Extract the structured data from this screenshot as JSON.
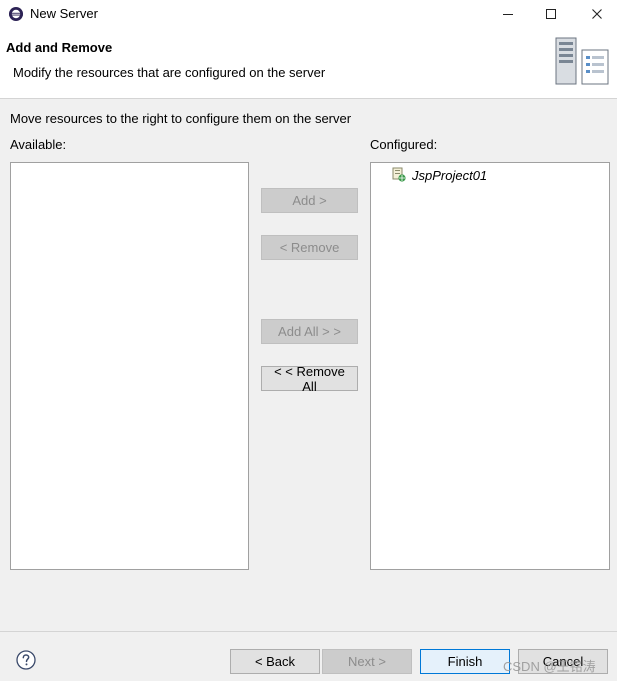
{
  "window": {
    "title": "New Server"
  },
  "header": {
    "title": "Add and Remove",
    "description": "Modify the resources that are configured on the server"
  },
  "main": {
    "instruction": "Move resources to the right to configure them on the server",
    "available": {
      "label": "Available:",
      "items": []
    },
    "configured": {
      "label": "Configured:",
      "items": [
        "JspProject01"
      ]
    }
  },
  "buttons": {
    "add": "Add >",
    "remove": "< Remove",
    "add_all": "Add All > >",
    "remove_all": "< < Remove All"
  },
  "footer": {
    "back": "< Back",
    "next": "Next >",
    "finish": "Finish",
    "cancel": "Cancel"
  },
  "watermark": "CSDN @王铭涛",
  "icons": {
    "app": "eclipse-icon",
    "server_banner": "server-banner-icon",
    "project": "web-project-icon",
    "help": "help-icon"
  }
}
